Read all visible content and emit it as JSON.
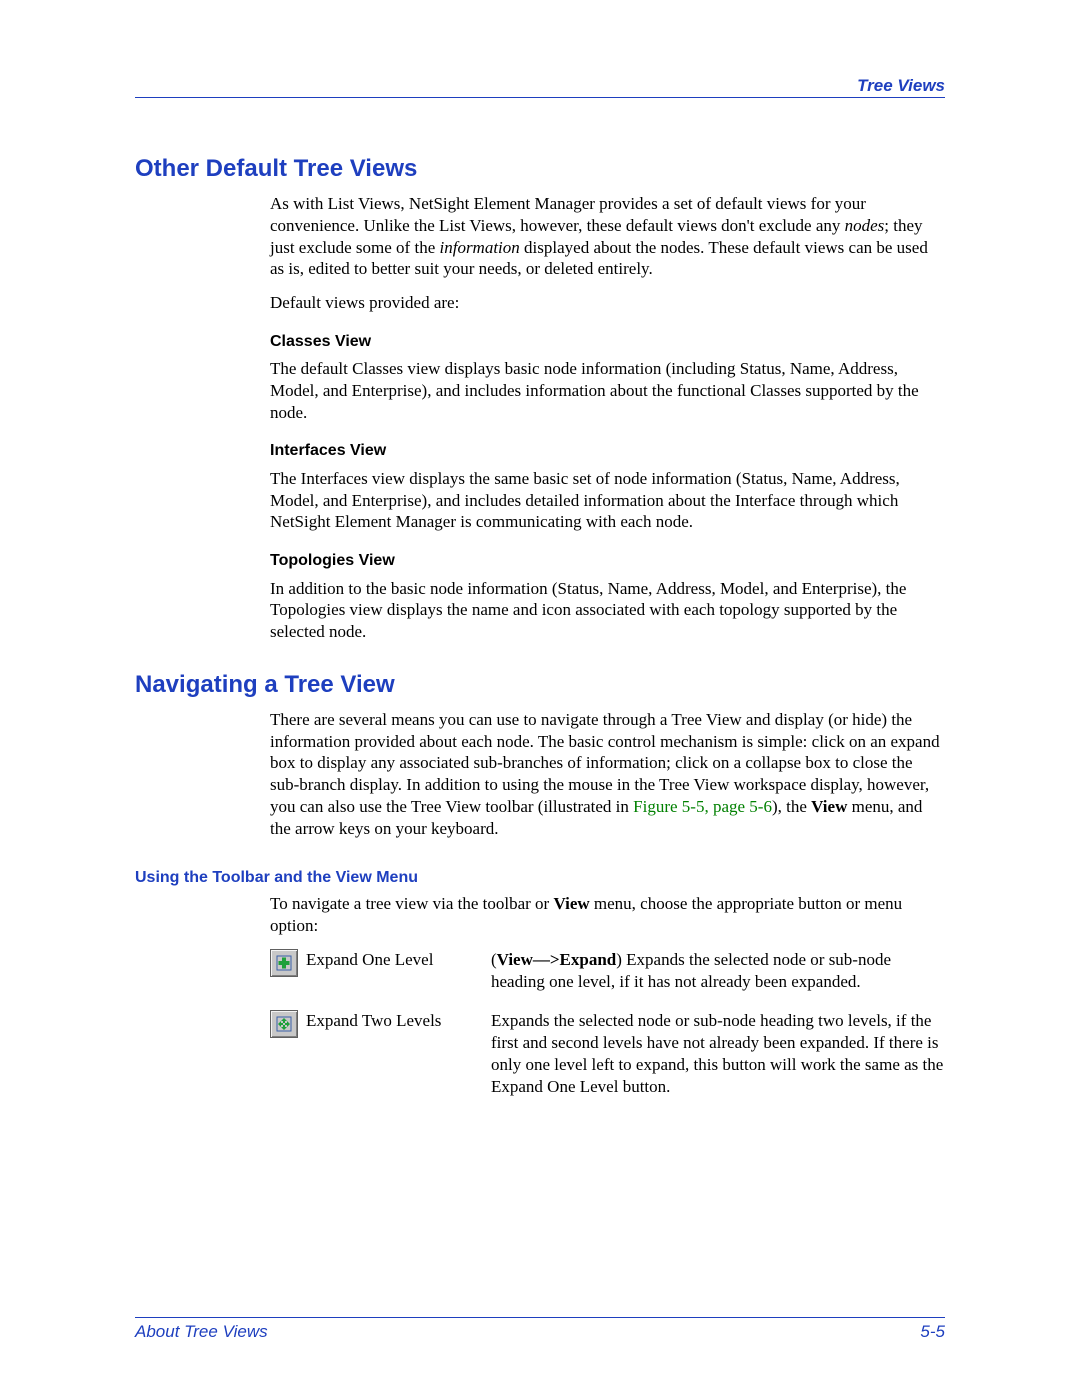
{
  "header": {
    "right": "Tree Views"
  },
  "section1": {
    "title": "Other Default Tree Views",
    "para1": {
      "r1": "As with List Views, NetSight Element Manager provides a set of default views for your convenience. Unlike the List Views, however, these default views don't exclude any ",
      "r2_em": "nodes",
      "r3": "; they just exclude some of the ",
      "r4_em": "information",
      "r5": " displayed about the nodes. These default views can be used as is, edited to better suit your needs, or deleted entirely."
    },
    "para2": "Default views provided are:",
    "classes": {
      "head": "Classes View",
      "body": "The default Classes view displays basic node information (including Status, Name, Address, Model, and Enterprise), and includes information about the functional Classes supported by the node."
    },
    "interfaces": {
      "head": "Interfaces View",
      "body": "The Interfaces view displays the same basic set of node information (Status, Name, Address, Model, and Enterprise), and includes detailed information about the Interface through which NetSight Element Manager is communicating with each node."
    },
    "topologies": {
      "head": "Topologies View",
      "body": "In addition to the basic node information (Status, Name, Address, Model, and Enterprise), the Topologies view displays the name and icon associated with each topology supported by the selected node."
    }
  },
  "section2": {
    "title": "Navigating a Tree View",
    "para": {
      "r1": "There are several means you can use to navigate through a Tree View and display (or hide) the information provided about each node. The basic control mechanism is simple: click on an expand box to display any associated sub-branches of information; click on a collapse box to close the sub-branch display. In addition to using the mouse in the Tree View workspace display, however, you can also use the Tree View toolbar (illustrated in ",
      "link": "Figure 5-5, page 5-6",
      "r2": "), the ",
      "r3_strong": "View",
      "r4": " menu, and the arrow keys on your keyboard."
    },
    "sub": {
      "head": "Using the Toolbar and the View Menu",
      "lead": {
        "r1": "To navigate a tree view via the toolbar or ",
        "r2_strong": "View",
        "r3": " menu, choose the appropriate button or menu option:"
      },
      "rows": [
        {
          "icon_name": "expand-one-level-icon",
          "label": "Expand One Level",
          "desc": {
            "r1_strong": "View—>Expand",
            "r2": ") Expands the selected node or sub-node heading one level, if it has not already been expanded.",
            "prefix": "("
          }
        },
        {
          "icon_name": "expand-two-levels-icon",
          "label": "Expand Two Levels",
          "desc": {
            "r1": "Expands the selected node or sub-node heading two levels, if the first and second levels have not already been expanded. If there is only one level left to expand, this button will work the same as the Expand One Level button."
          }
        }
      ]
    }
  },
  "footer": {
    "left": "About Tree Views",
    "right": "5-5"
  }
}
